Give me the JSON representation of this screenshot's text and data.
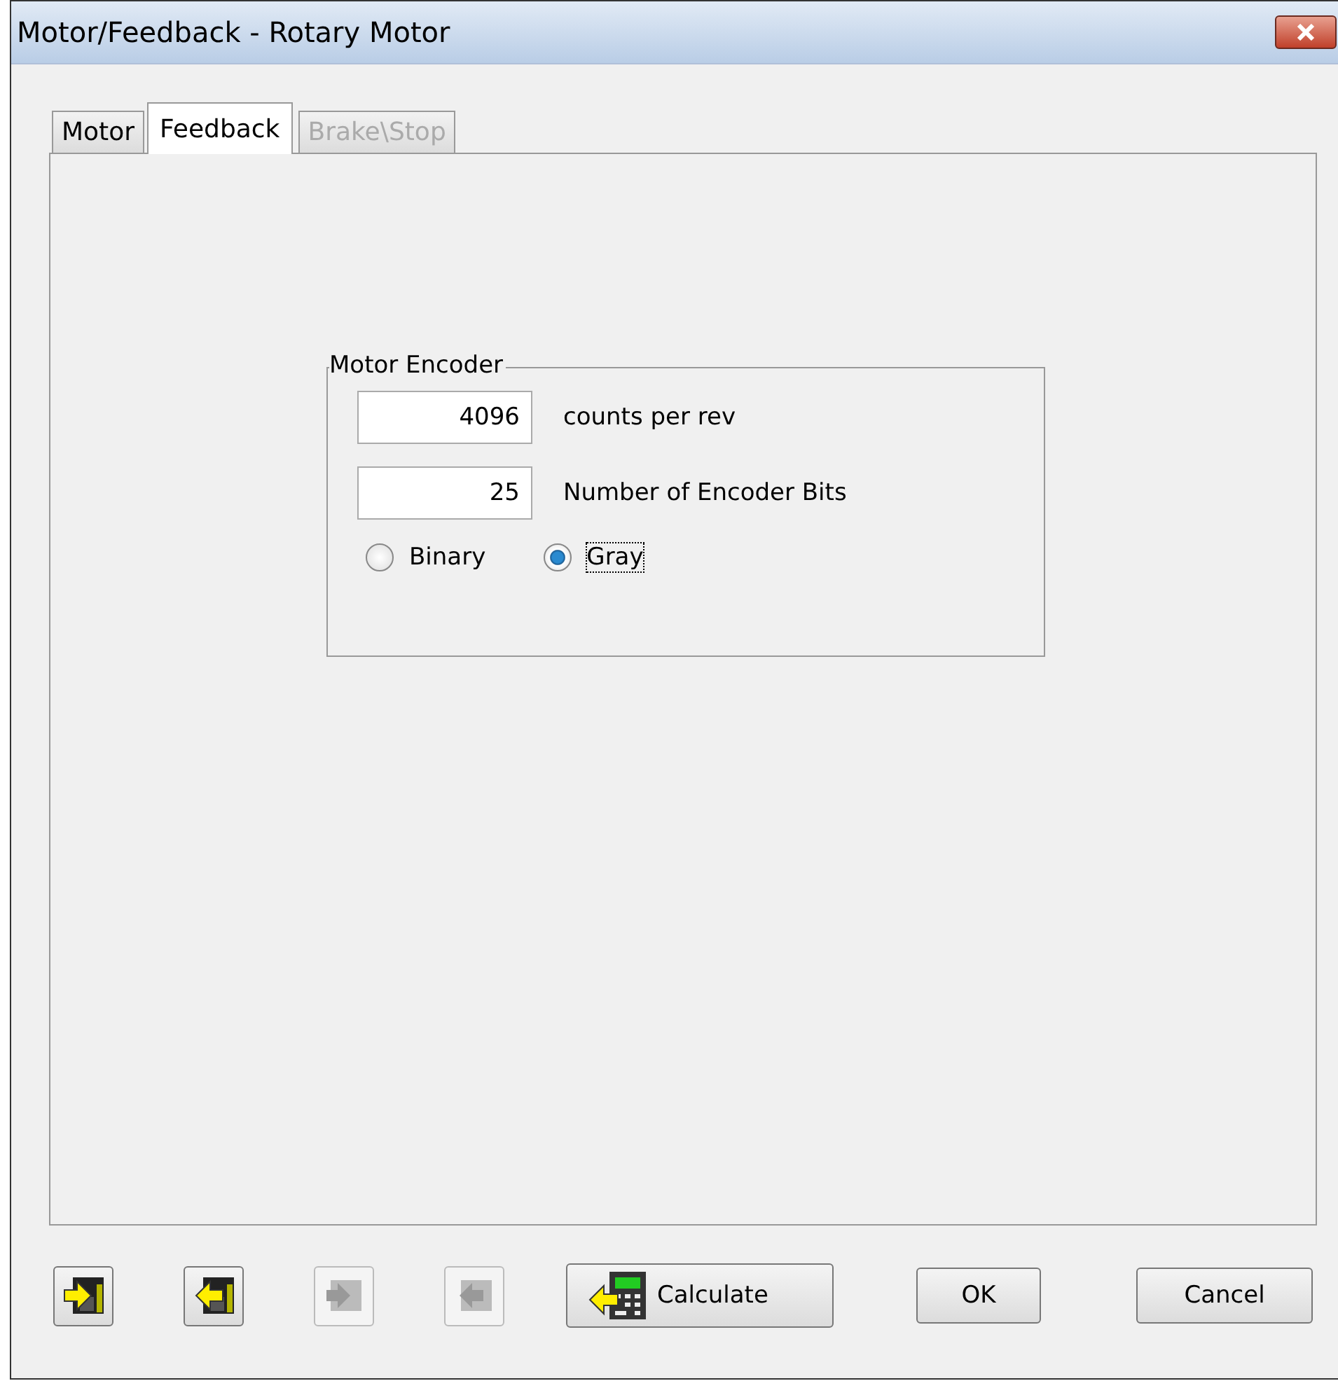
{
  "window": {
    "title": "Motor/Feedback - Rotary Motor"
  },
  "tabs": [
    {
      "label": "Motor",
      "selected": false,
      "disabled": false
    },
    {
      "label": "Feedback",
      "selected": true,
      "disabled": false
    },
    {
      "label": "Brake\\Stop",
      "selected": false,
      "disabled": true
    }
  ],
  "group": {
    "title": "Motor Encoder",
    "fields": [
      {
        "value": "4096",
        "label": "counts per rev"
      },
      {
        "value": "25",
        "label": "Number of Encoder Bits"
      }
    ],
    "radios": [
      {
        "label": "Binary",
        "selected": false,
        "focused": false
      },
      {
        "label": "Gray",
        "selected": true,
        "focused": true
      }
    ]
  },
  "toolbar": [
    {
      "kind": "import",
      "disabled": false
    },
    {
      "kind": "export",
      "disabled": false
    },
    {
      "kind": "import",
      "disabled": true
    },
    {
      "kind": "export",
      "disabled": true
    }
  ],
  "calculate": {
    "label": "Calculate"
  },
  "buttons": [
    "OK",
    "Cancel"
  ]
}
